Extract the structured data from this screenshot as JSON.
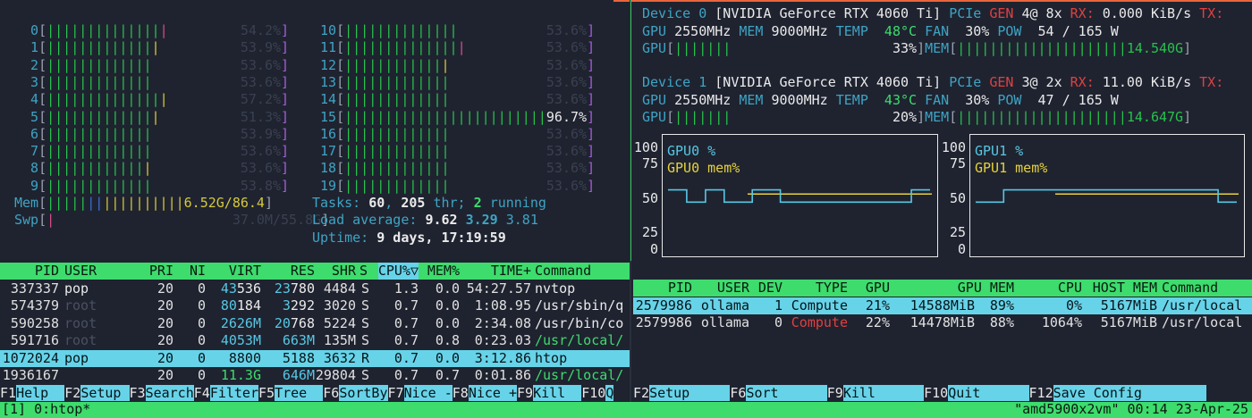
{
  "htop": {
    "cpus_left": [
      {
        "id": "0",
        "pct": "54.2%",
        "bars": 15,
        "tail": "red"
      },
      {
        "id": "1",
        "pct": "53.9%",
        "bars": 14,
        "tail": "yellow"
      },
      {
        "id": "2",
        "pct": "53.6%",
        "bars": 13,
        "tail": "green"
      },
      {
        "id": "3",
        "pct": "53.6%",
        "bars": 13,
        "tail": "green"
      },
      {
        "id": "4",
        "pct": "57.2%",
        "bars": 15,
        "tail": "yellow"
      },
      {
        "id": "5",
        "pct": "51.3%",
        "bars": 14,
        "tail": "yellow"
      },
      {
        "id": "6",
        "pct": "53.9%",
        "bars": 13,
        "tail": "green"
      },
      {
        "id": "7",
        "pct": "53.6%",
        "bars": 13,
        "tail": "green"
      },
      {
        "id": "8",
        "pct": "53.6%",
        "bars": 13,
        "tail": "yellow"
      },
      {
        "id": "9",
        "pct": "53.8%",
        "bars": 13,
        "tail": "green"
      }
    ],
    "cpus_right": [
      {
        "id": "10",
        "pct": "53.6%",
        "bars": 14,
        "tail": "green"
      },
      {
        "id": "11",
        "pct": "53.6%",
        "bars": 15,
        "tail": "red"
      },
      {
        "id": "12",
        "pct": "53.6%",
        "bars": 13,
        "tail": "yellow"
      },
      {
        "id": "13",
        "pct": "53.6%",
        "bars": 13,
        "tail": "green"
      },
      {
        "id": "14",
        "pct": "53.6%",
        "bars": 13,
        "tail": "green"
      },
      {
        "id": "15",
        "pct": "96.7%",
        "bars": 25,
        "tail": "green"
      },
      {
        "id": "16",
        "pct": "53.6%",
        "bars": 13,
        "tail": "green"
      },
      {
        "id": "17",
        "pct": "53.6%",
        "bars": 13,
        "tail": "green"
      },
      {
        "id": "18",
        "pct": "53.6%",
        "bars": 13,
        "tail": "green"
      },
      {
        "id": "19",
        "pct": "53.6%",
        "bars": 13,
        "tail": "green"
      }
    ],
    "mem": {
      "label": "Mem",
      "value": "6.52G/86.4"
    },
    "swp": {
      "label": "Swp",
      "value": "37.0M/55.8G"
    },
    "tasks": {
      "label": "Tasks:",
      "tasks": "60",
      "thr": "205",
      "thr_label": "thr;",
      "running": "2",
      "running_label": "running"
    },
    "load": {
      "label": "Load average:",
      "l1": "9.62",
      "l5": "3.29",
      "l15": "3.81"
    },
    "uptime": {
      "label": "Uptime:",
      "value": "9 days, 17:19:59"
    },
    "columns": [
      "PID",
      "USER",
      "PRI",
      "NI",
      "VIRT",
      "RES",
      "SHR",
      "S",
      "CPU%▽",
      "MEM%",
      "TIME+",
      "Command"
    ],
    "processes": [
      {
        "pid": "337337",
        "user": "pop",
        "pri": "20",
        "ni": "0",
        "virt_a": "43",
        "virt_b": "536",
        "res_a": "23",
        "res_b": "780",
        "shr": "4484",
        "s": "S",
        "cpu": "1.3",
        "mem": "0.0",
        "time": "54:27.57",
        "cmd": "nvtop",
        "cmd_color": "white",
        "sel": false
      },
      {
        "pid": "574379",
        "user": "root",
        "pri": "20",
        "ni": "0",
        "virt_a": "80",
        "virt_b": "184",
        "res_a": "3",
        "res_b": "292",
        "shr": "3020",
        "s": "S",
        "cpu": "0.7",
        "mem": "0.0",
        "time": "1:08.95",
        "cmd": "/usr/sbin/q",
        "cmd_color": "white",
        "sel": false
      },
      {
        "pid": "590258",
        "user": "root",
        "pri": "20",
        "ni": "0",
        "virt_a": "2626M",
        "virt_b": "",
        "res_a": "20",
        "res_b": "768",
        "shr": "5224",
        "s": "S",
        "cpu": "0.7",
        "mem": "0.0",
        "time": "2:34.08",
        "cmd": "/usr/bin/co",
        "cmd_color": "white",
        "sel": false
      },
      {
        "pid": "591716",
        "user": "root",
        "pri": "20",
        "ni": "0",
        "virt_a": "4053M",
        "virt_b": "",
        "res_a": "663M",
        "res_b": "",
        "shr": "135M",
        "s": "S",
        "cpu": "0.7",
        "mem": "0.8",
        "time": "0:23.03",
        "cmd": "/usr/local/",
        "cmd_color": "green",
        "sel": false
      },
      {
        "pid": "1072024",
        "user": "pop",
        "pri": "20",
        "ni": "0",
        "virt_a": "8800",
        "virt_b": "",
        "res_a": "5188",
        "res_b": "",
        "shr": "3632",
        "s": "R",
        "cpu": "0.7",
        "mem": "0.0",
        "time": "3:12.86",
        "cmd": "htop",
        "cmd_color": "white",
        "sel": true
      },
      {
        "pid": "1936167",
        "user": "",
        "pri": "20",
        "ni": "0",
        "virt_a": "11.3G",
        "virt_b": "",
        "res_a": "646M",
        "res_b": "",
        "shr": "29804",
        "s": "S",
        "cpu": "0.7",
        "mem": "0.7",
        "time": "0:01.86",
        "cmd": "/usr/local/",
        "cmd_color": "green",
        "sel": false
      }
    ],
    "fkeys": [
      {
        "n": "F1",
        "t": "Help  "
      },
      {
        "n": "F2",
        "t": "Setup "
      },
      {
        "n": "F3",
        "t": "Search"
      },
      {
        "n": "F4",
        "t": "Filter"
      },
      {
        "n": "F5",
        "t": "Tree  "
      },
      {
        "n": "F6",
        "t": "SortBy"
      },
      {
        "n": "F7",
        "t": "Nice -"
      },
      {
        "n": "F8",
        "t": "Nice +"
      },
      {
        "n": "F9",
        "t": "Kill  "
      },
      {
        "n": "F10",
        "t": "Q"
      }
    ]
  },
  "nvtop": {
    "devices": [
      {
        "label": "Device 0",
        "name": "[NVIDIA GeForce RTX 4060 Ti]",
        "pcie": "PCIe",
        "gen": "GEN",
        "gen_val": "4@ 8x",
        "rx_label": "RX:",
        "rx": "0.000 KiB/s",
        "tx_label": "TX:",
        "gpu_clk": "2550MHz",
        "mem_clk": "9000MHz",
        "temp": "48°C",
        "fan": "30%",
        "pow": "54 / 165 W",
        "gpu_pct": "33%",
        "gpu_bars": 7,
        "mem_used": "14.540G",
        "mem_bars": 21
      },
      {
        "label": "Device 1",
        "name": "[NVIDIA GeForce RTX 4060 Ti]",
        "pcie": "PCIe",
        "gen": "GEN",
        "gen_val": "3@ 2x",
        "rx_label": "RX:",
        "rx": "11.00 KiB/s",
        "tx_label": "TX:",
        "gpu_clk": "2550MHz",
        "mem_clk": "9000MHz",
        "temp": "43°C",
        "fan": "30%",
        "pow": "47 / 165 W",
        "gpu_pct": "20%",
        "gpu_bars": 7,
        "mem_used": "14.647G",
        "mem_bars": 21
      }
    ],
    "labels": {
      "gpu": "GPU",
      "mem": "MEM",
      "temp": "TEMP",
      "fan": "FAN",
      "pow": "POW",
      "gpu_bar": "GPU",
      "mem_bar": "MEM"
    },
    "graphs": [
      {
        "title": "GPU0 %",
        "mem_label": "GPU0 mem%",
        "mem_level": 89,
        "util": [
          38,
          38,
          25,
          25,
          38,
          38,
          25,
          25,
          25,
          38,
          38,
          38,
          25,
          25,
          25,
          25,
          25,
          25,
          25,
          25,
          25,
          25,
          25,
          25,
          25,
          25,
          38,
          38
        ]
      },
      {
        "title": "GPU1 %",
        "mem_label": "GPU1 mem%",
        "mem_level": 88,
        "util": [
          25,
          25,
          25,
          38,
          38,
          38,
          38,
          38,
          38,
          38,
          38,
          38,
          38,
          38,
          38,
          38,
          38,
          38,
          38,
          38,
          38,
          38,
          38,
          38,
          38,
          38,
          25,
          25
        ]
      }
    ],
    "yticks": [
      "100",
      "75",
      "50",
      "25",
      "0"
    ],
    "columns": {
      "pid": "PID",
      "user": "USER",
      "dev": "DEV",
      "type": "TYPE",
      "gpu": "GPU",
      "gpu_mem": "GPU MEM",
      "cpu": "CPU",
      "host_mem": "HOST MEM",
      "cmd": "Command"
    },
    "processes": [
      {
        "pid": "2579986",
        "user": "ollama",
        "dev": "1",
        "type": "Compute",
        "gpu": "21%",
        "gpu_mem": "14588MiB",
        "gpu_mem_pct": "89%",
        "cpu": "0%",
        "host_mem": "5167MiB",
        "cmd": "/usr/local",
        "sel": true
      },
      {
        "pid": "2579986",
        "user": "ollama",
        "dev": "0",
        "type": "Compute",
        "gpu": "22%",
        "gpu_mem": "14478MiB",
        "gpu_mem_pct": "88%",
        "cpu": "1064%",
        "host_mem": "5167MiB",
        "cmd": "/usr/local",
        "sel": false
      }
    ],
    "fkeys": [
      {
        "n": "F2",
        "t": "Setup     "
      },
      {
        "n": "F6",
        "t": "Sort      "
      },
      {
        "n": "F9",
        "t": "Kill      "
      },
      {
        "n": "F10",
        "t": "Quit      "
      },
      {
        "n": "F12",
        "t": "Save Config        "
      }
    ]
  },
  "tmux": {
    "left": "[1] 0:htop*",
    "host": "\"amd5900x2vm\"",
    "time": "00:14",
    "date": "23-Apr-25"
  },
  "colors": {
    "accent": "#3ddc6d",
    "select": "#67d3e8",
    "background": "#1f2330"
  }
}
